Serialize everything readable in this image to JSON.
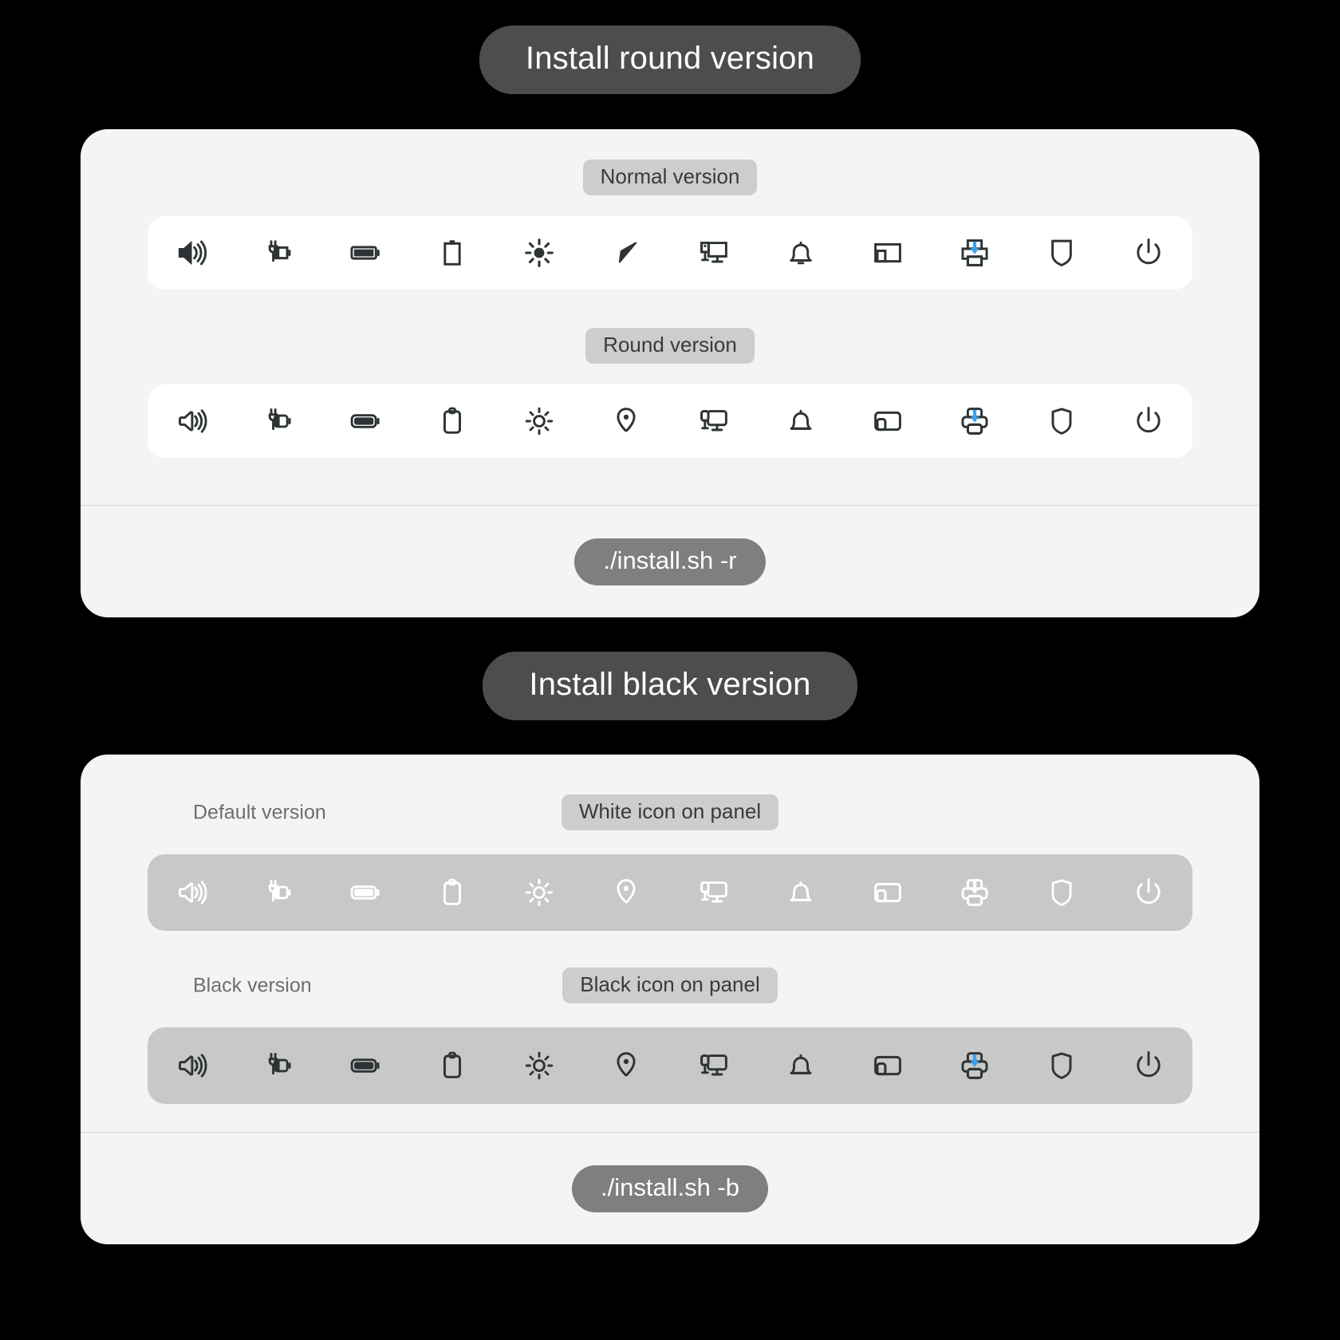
{
  "sections": [
    {
      "title": "Install round version",
      "command": "./install.sh -r",
      "rows": [
        {
          "badge": "Normal version",
          "side_label": "",
          "style": "white-panel-dark-icons",
          "icon_variant": "normal",
          "icons": [
            "volume-high-icon",
            "battery-charging-icon",
            "battery-full-icon",
            "clipboard-icon",
            "brightness-icon",
            "location-arrow-icon",
            "display-settings-icon",
            "bell-icon",
            "devices-icon",
            "printer-download-icon",
            "shield-icon",
            "power-icon"
          ]
        },
        {
          "badge": "Round version",
          "side_label": "",
          "style": "white-panel-dark-icons",
          "icon_variant": "round",
          "icons": [
            "volume-high-icon",
            "battery-charging-icon",
            "battery-full-icon",
            "clipboard-icon",
            "brightness-icon",
            "location-pin-icon",
            "display-settings-icon",
            "bell-icon",
            "devices-icon",
            "printer-download-icon",
            "shield-icon",
            "power-icon"
          ]
        }
      ]
    },
    {
      "title": "Install black version",
      "command": "./install.sh -b",
      "rows": [
        {
          "badge": "White icon on panel",
          "side_label": "Default version",
          "style": "grey-panel-white-icons",
          "icon_variant": "round",
          "icons": [
            "volume-high-icon",
            "battery-charging-icon",
            "battery-full-icon",
            "clipboard-icon",
            "brightness-icon",
            "location-pin-icon",
            "display-settings-icon",
            "bell-icon",
            "devices-icon",
            "printer-download-icon",
            "shield-icon",
            "power-icon"
          ]
        },
        {
          "badge": "Black icon on panel",
          "side_label": "Black version",
          "style": "grey-panel-black-icons",
          "icon_variant": "round",
          "icons": [
            "volume-high-icon",
            "battery-charging-icon",
            "battery-full-icon",
            "clipboard-icon",
            "brightness-icon",
            "location-pin-icon",
            "display-settings-icon",
            "bell-icon",
            "devices-icon",
            "printer-download-icon",
            "shield-icon",
            "power-icon"
          ]
        }
      ]
    }
  ],
  "colors": {
    "background": "#000000",
    "card": "#f4f4f4",
    "title_pill": "#4d4d4d",
    "command_pill": "#7f7f7f",
    "badge": "#cdcdcd",
    "strip_white": "#ffffff",
    "strip_grey": "#c8c8c8",
    "icon_dark": "#2e3436",
    "icon_white": "#ffffff",
    "accent_blue": "#3aa3f0"
  }
}
